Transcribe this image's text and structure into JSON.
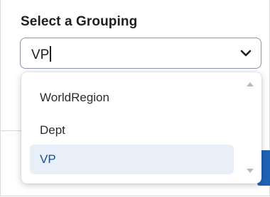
{
  "title": "Select a Grouping",
  "select": {
    "value": "VP",
    "icon": "chevron-down-icon"
  },
  "dropdown": {
    "options": [
      {
        "label": "WorldRegion",
        "selected": false
      },
      {
        "label": "Dept",
        "selected": false
      },
      {
        "label": "VP",
        "selected": true
      }
    ]
  },
  "colors": {
    "selected_bg": "#e8eff9",
    "selected_text": "#1a4f96",
    "accent": "#1e63b8"
  }
}
